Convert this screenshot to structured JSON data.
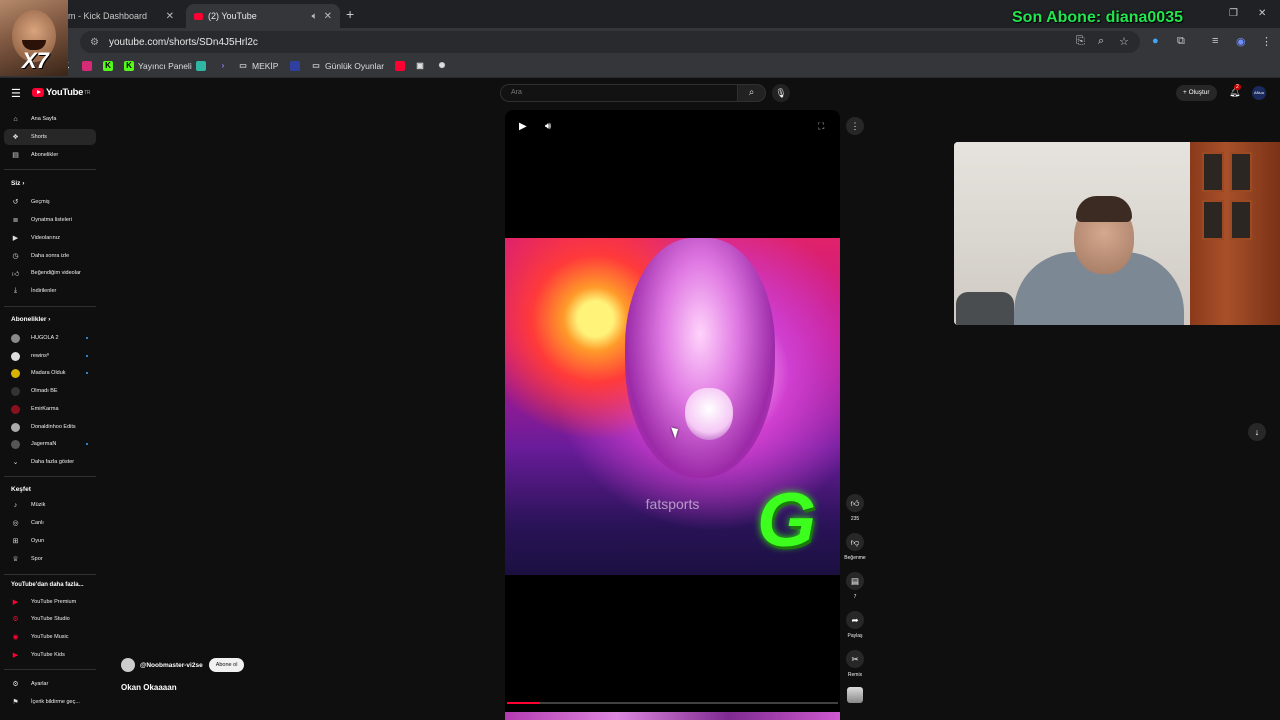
{
  "browser": {
    "tabs": [
      {
        "title": "m - Kick Dashboard",
        "active": false
      },
      {
        "title": "(2) YouTube",
        "active": true
      }
    ],
    "url": "youtube.com/shorts/SDn4J5Hrl2c",
    "bookmarks": [
      {
        "label": "Yayıncı Paneli"
      },
      {
        "label": "MEKİP"
      },
      {
        "label": "Günlük Oyunlar"
      }
    ]
  },
  "overlay": {
    "subscriber_banner": "Son Abone: diana0035",
    "meme_text": "X7"
  },
  "youtube": {
    "logo": "YouTube",
    "logo_region": "TR",
    "search_placeholder": "Ara",
    "create_label": "Oluştur",
    "notifications": "2",
    "avatar_label": "ANuu"
  },
  "sidebar": {
    "main": [
      {
        "label": "Ana Sayfa",
        "icon": "home-icon"
      },
      {
        "label": "Shorts",
        "icon": "shorts-icon",
        "active": true
      },
      {
        "label": "Abonelikler",
        "icon": "subscriptions-icon"
      }
    ],
    "you_header": "Siz",
    "you": [
      {
        "label": "Geçmiş",
        "icon": "history-icon"
      },
      {
        "label": "Oynatma listeleri",
        "icon": "playlist-icon"
      },
      {
        "label": "Videolarınız",
        "icon": "video-icon"
      },
      {
        "label": "Daha sonra izle",
        "icon": "clock-icon"
      },
      {
        "label": "Beğendiğim videolar",
        "icon": "like-icon"
      },
      {
        "label": "İndirilenler",
        "icon": "download-icon"
      }
    ],
    "subs_header": "Abonelikler",
    "subscriptions": [
      {
        "label": "HUGOLA 2",
        "dot": true,
        "color": "#8a8a8a"
      },
      {
        "label": "rewinsº",
        "dot": true,
        "color": "#dddddd"
      },
      {
        "label": "Madara Olduk",
        "dot": true,
        "color": "#d8b300"
      },
      {
        "label": "Olmadı BE",
        "dot": false,
        "color": "#333333"
      },
      {
        "label": "EmirKarma",
        "dot": false,
        "color": "#8a1020"
      },
      {
        "label": "Donaldinhoo Edits",
        "dot": false,
        "color": "#aaaaaa"
      },
      {
        "label": "JagermaN",
        "dot": true,
        "color": "#555555"
      }
    ],
    "show_more": "Daha fazla göster",
    "explore_header": "Keşfet",
    "explore": [
      {
        "label": "Müzik",
        "icon": "music-icon"
      },
      {
        "label": "Canlı",
        "icon": "live-icon"
      },
      {
        "label": "Oyun",
        "icon": "gaming-icon"
      },
      {
        "label": "Spor",
        "icon": "trophy-icon"
      }
    ],
    "more_header": "YouTube'dan daha fazla...",
    "more": [
      {
        "label": "YouTube Premium"
      },
      {
        "label": "YouTube Studio"
      },
      {
        "label": "YouTube Music"
      },
      {
        "label": "YouTube Kids"
      }
    ],
    "settings": [
      {
        "label": "Ayarlar",
        "icon": "gear-icon"
      },
      {
        "label": "İçerik bildirme geç...",
        "icon": "flag-icon"
      }
    ]
  },
  "short": {
    "watermark": "fatsports",
    "channel": "@Noobmaster-vi2se",
    "subscribe_label": "Abone ol",
    "title": "Okan Okaaaan",
    "progress": 0.1,
    "likes": "235",
    "dislike_label": "Beğenme",
    "comments": "7",
    "share_label": "Paylaş",
    "remix_label": "Remix"
  }
}
